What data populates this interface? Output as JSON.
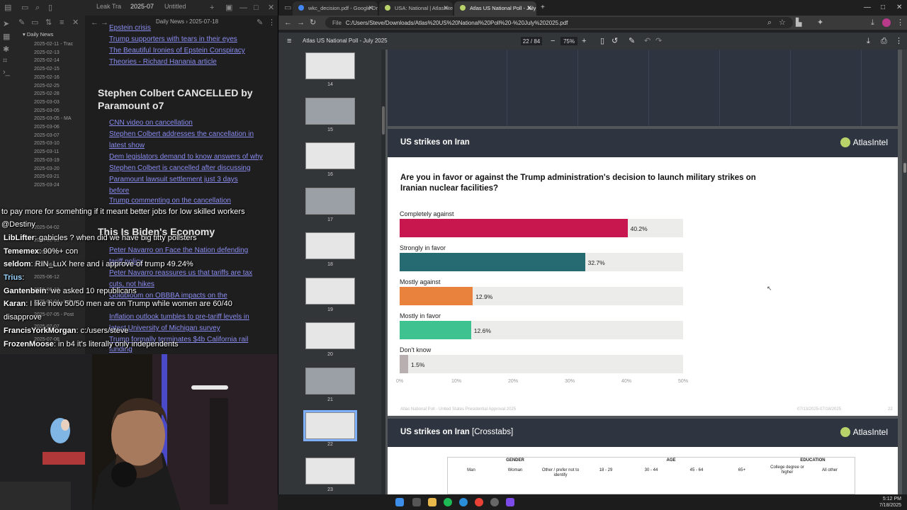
{
  "obsidian": {
    "tabs": [
      "Leak Tra",
      "2025-07",
      "Untitled"
    ],
    "note_title": "Daily News › 2025-07-18",
    "folder": "Daily News",
    "dates": [
      "2025-02-11 - Trac",
      "2025-02-13",
      "2025-02-14",
      "2025-02-15",
      "2025-02-16",
      "2025-02-25",
      "2025-02-28",
      "2025-03-03",
      "2025-03-05",
      "2025-03-05 - MA",
      "2025-03-06",
      "2025-03-07",
      "2025-03-10",
      "2025-03-11",
      "2025-03-19",
      "2025-03-20",
      "2025-03-21",
      "2025-03-24"
    ],
    "dates_lower": [
      "2025-04-02",
      "2025-06-08",
      "2025-06-10",
      "2025-06-11",
      "2025-06-12",
      "2025-06-13",
      "2025-07-04 - Inde",
      "2025-07-05 - Post",
      "2025-07-07",
      "2025-07-08"
    ],
    "links_top": [
      "Epstein crisis",
      "Trump supporters with tears in their eyes",
      "The Beautiful Ironies of Epstein Conspiracy",
      "Theories - Richard Hanania article"
    ],
    "heading1": "Stephen Colbert CANCELLED by Paramount o7",
    "links_colbert": [
      "CNN video on cancellation",
      "Stephen Colbert addresses the cancellation in",
      "latest show",
      "Dem legislators demand to know answers of why",
      "Stephen Colbert is cancelled after discussing",
      "Paramount lawsuit settlement just 3 days",
      "before",
      "Trump commenting on the cancellation"
    ],
    "heading2": "This Is Biden's Economy",
    "links_economy": [
      "Peter Navarro on Face the Nation defending",
      "tariff policy",
      "Peter Navarro reassures us that tariffs are tax",
      "cuts, not hikes",
      "Goldbloom on OBBBA impacts on the",
      "Inflation outlook tumbles to pre-tariff levels in",
      "latest University of Michigan survey",
      "Trump formally terminates $4b California rail",
      "funding"
    ]
  },
  "chat": [
    {
      "user": "",
      "text": "to pay more for somehting if it meant better jobs for low skilled workers"
    },
    {
      "user": "",
      "text": "@Destiny"
    },
    {
      "user": "LibLifter",
      "text": ": gabicles ? when did we have big titty pollsters"
    },
    {
      "user": "Tememex",
      "text": ": 90%+ con"
    },
    {
      "user": "seldom",
      "text": ": RIN_LuX here and i approve of trump 49.24%"
    },
    {
      "user": "Trius",
      "text": ":"
    },
    {
      "user": "Gantenbein",
      "text": ": we asked 10 republicans"
    },
    {
      "user": "Karan",
      "text": ": I like how 50/50 men are on Trump while women are 60/40"
    },
    {
      "user": "",
      "text": "disapprove"
    },
    {
      "user": "FrancisYorkMorgan",
      "text": ": c:/users/steve"
    },
    {
      "user": "FrozenMoose",
      "text": ": in b4 it's literally only independents"
    }
  ],
  "browser": {
    "tabs": [
      "wkc_decision.pdf - Google Driv",
      "USA: National | AtlasIntel",
      "Atlas US National Poll - July 20"
    ],
    "address_prefix": "File",
    "address": "C:/Users/Steve/Downloads/Atlas%20US%20National%20Poll%20-%20July%202025.pdf",
    "pdf_title": "Atlas US National Poll - July 2025",
    "page_current": "22",
    "page_total": "/ 84",
    "zoom": "75%",
    "thumb_labels": [
      "14",
      "15",
      "16",
      "17",
      "18",
      "19",
      "20",
      "21",
      "22",
      "23"
    ]
  },
  "slide": {
    "title": "US strikes on Iran",
    "brand": "AtlasIntel",
    "question": "Are you in favor or against the Trump administration's decision to launch military strikes on Iranian nuclear facilities?",
    "footer_left": "Atlas National Poll - United States Presidential Approval 2025",
    "footer_date": "07/13/2025-07/18/2025",
    "footer_page": "22"
  },
  "chart_data": {
    "type": "bar",
    "orientation": "horizontal",
    "title": "Are you in favor or against the Trump administration's decision to launch military strikes on Iranian nuclear facilities?",
    "categories": [
      "Completely against",
      "Strongly in favor",
      "Mostly against",
      "Mostly in favor",
      "Don't know"
    ],
    "values": [
      40.2,
      32.7,
      12.9,
      12.6,
      1.5
    ],
    "value_labels": [
      "40.2%",
      "32.7%",
      "12.9%",
      "12.6%",
      "1.5%"
    ],
    "colors": [
      "#c8174f",
      "#276b72",
      "#e8823d",
      "#3ec28f",
      "#b8b0b0"
    ],
    "xlim": [
      0,
      50
    ],
    "xticks": [
      "0%",
      "10%",
      "20%",
      "30%",
      "40%",
      "50%"
    ]
  },
  "slide2": {
    "title": "US strikes on Iran",
    "subtitle": "[Crosstabs]",
    "brand": "AtlasIntel",
    "groups": [
      "GENDER",
      "AGE",
      "EDUCATION"
    ],
    "subs": [
      "Man",
      "Woman",
      "Other / prefer not to identify",
      "18 - 29",
      "30 - 44",
      "45 - 64",
      "65+",
      "College degree or higher",
      "All other"
    ]
  },
  "taskbar": {
    "time": "5:12 PM",
    "date": "7/18/2025"
  }
}
